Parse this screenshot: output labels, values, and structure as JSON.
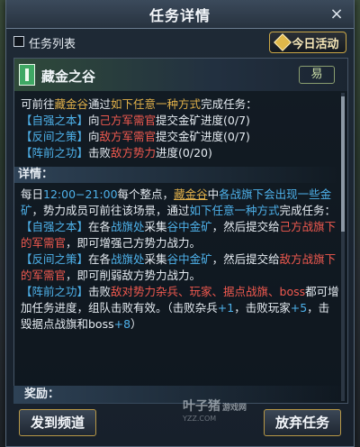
{
  "window": {
    "title": "任务详情",
    "close_glyph": "×"
  },
  "toolbar": {
    "task_list_label": "任务列表",
    "today_activity_label": "今日活动"
  },
  "quest": {
    "name": "藏金之谷",
    "tag": "易"
  },
  "objective": {
    "intro": [
      "可前往",
      "藏金谷",
      "通过",
      "如下任意一种方式",
      "完成任务："
    ],
    "lines": [
      {
        "tag": "【自强之本】",
        "pre": "向",
        "target": "己方军需官",
        "post": "提交金矿进度(0/7)"
      },
      {
        "tag": "【反间之策】",
        "pre": "向",
        "target": "敌方军需官",
        "post": "提交金矿进度(0/7)"
      },
      {
        "tag": "【阵前之功】",
        "pre": "击败",
        "target": "敌方势力",
        "post": "进度(0/20)"
      }
    ]
  },
  "details": {
    "heading": "详情：",
    "p1": {
      "a": "每日",
      "time": "12:00−21:00",
      "b": "每个整点，",
      "place": "藏金谷",
      "c": "中",
      "where": "各战旗下会出现一些金矿",
      "d": "，势力成员可前往该场景，通过",
      "way": "如下任意一种方式",
      "e": "完成任务："
    },
    "p2": {
      "tag": "【自强之本】",
      "a": "在各",
      "where": "战旗处",
      "b": "采集",
      "item": "谷中金矿",
      "c": "，然后提交给",
      "target": "己方战旗下的军需官",
      "d": "，即可增强己方势力战力。"
    },
    "p3": {
      "tag": "【反间之策】",
      "a": "在各",
      "where": "战旗处",
      "b": "采集",
      "item": "谷中金矿",
      "c": "，然后提交给",
      "target": "敌方战旗下的军需官",
      "d": "，即可削弱敌方势力战力。"
    },
    "p4": {
      "tag": "【阵前之功】",
      "a": "击败",
      "target": "敌对势力杂兵、玩家、据点战旗、boss",
      "b": "都可增加任务进度，组队击败有效。（击败杂兵",
      "n1": "+1",
      "c": "，击败玩家",
      "n2": "+5",
      "d": "，击毁据点战旗和boss",
      "n3": "+8",
      "e": "）"
    }
  },
  "reward": {
    "heading": "奖励："
  },
  "footer": {
    "channel_button": "发到频道",
    "abandon_button": "放弃任务"
  },
  "watermark": {
    "main": "叶子猪",
    "badge": "游戏网",
    "url": "YZZ.COM"
  }
}
